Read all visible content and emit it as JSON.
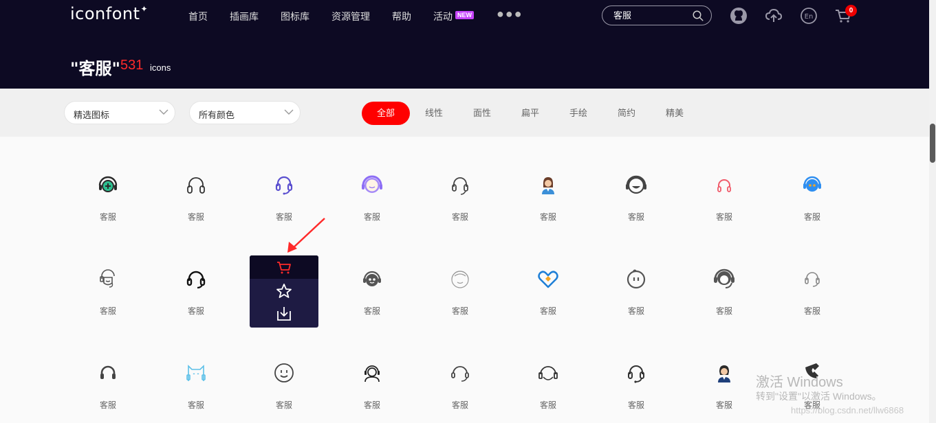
{
  "header": {
    "logo": "iconfont",
    "nav": [
      "首页",
      "插画库",
      "图标库",
      "资源管理",
      "帮助",
      "活动"
    ],
    "new_badge": "NEW",
    "search_value": "客服",
    "cart_count": "0",
    "lang_label": "En"
  },
  "query": {
    "title": "\"客服\"",
    "count": "531",
    "unit": "icons"
  },
  "filters": {
    "select1": "精选图标",
    "select2": "所有颜色",
    "tabs": [
      "全部",
      "线性",
      "面性",
      "扁平",
      "手绘",
      "简约",
      "精美"
    ],
    "active_tab": "全部"
  },
  "icons": {
    "label": "客服",
    "rows": [
      [
        "headset-plus-teal",
        "headphones-outline",
        "headset-purple",
        "agent-face-purple",
        "headset-gray",
        "agent-woman",
        "smile-face-headset",
        "headphones-red",
        "bubble-blue-dots"
      ],
      [
        "agent-line-face",
        "headset-black",
        "hover-overlay",
        "robot-face-gray",
        "agent-face-thin",
        "heart-handshake-blue",
        "round-face",
        "agent-avatar-gray",
        "headset-light"
      ],
      [
        "headset-small",
        "cat-headset-blue",
        "smile-round",
        "agent-person-outline",
        "headset-mic",
        "headset-wide",
        "headset-mic-2",
        "agent-woman-2",
        "phone-dark"
      ]
    ]
  },
  "overlay": {
    "actions": [
      "cart-icon",
      "star-icon",
      "download-icon"
    ]
  },
  "watermark": {
    "line1": "激活 Windows",
    "line2": "转到\"设置\"以激活 Windows。",
    "line3": "https://blog.csdn.net/llw6868"
  },
  "colors": {
    "header_bg": "#0d0a23",
    "accent_red": "#ff0000",
    "badge_purple": "#c644fc"
  }
}
